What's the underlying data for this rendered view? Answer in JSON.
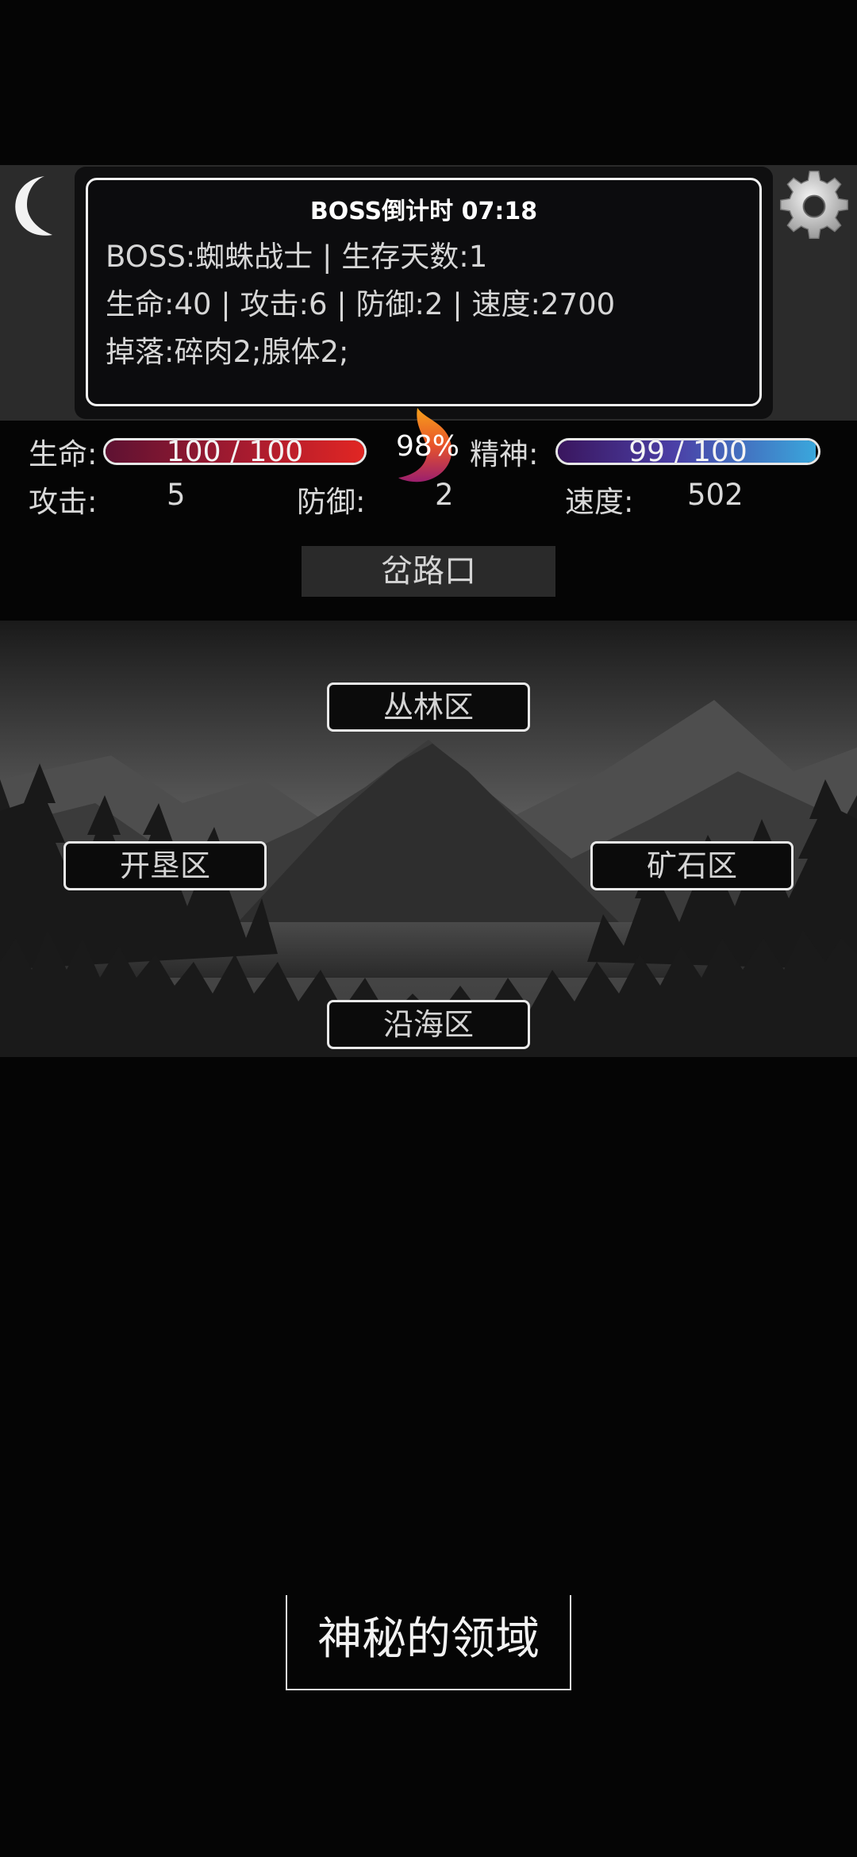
{
  "boss": {
    "title": "BOSS倒计时 07:18",
    "line1": "BOSS:蜘蛛战士 | 生存天数:1",
    "line2": "生命:40 | 攻击:6 | 防御:2 | 速度:2700",
    "line3": "掉落:碎肉2;腺体2;"
  },
  "stats": {
    "hp_label": "生命:",
    "hp_text": "100 / 100",
    "hp_fraction": 1.0,
    "spirit_percent": "98%",
    "mp_label": "精神:",
    "mp_text": "99 / 100",
    "mp_fraction": 0.99,
    "attack_label": "攻击:",
    "attack_value": "5",
    "defense_label": "防御:",
    "defense_value": "2",
    "speed_label": "速度:",
    "speed_value": "502"
  },
  "location": "岔路口",
  "zones": {
    "north": "丛林区",
    "west": "开垦区",
    "east": "矿石区",
    "south": "沿海区"
  },
  "footer": {
    "realm": "神秘的领域"
  },
  "icons": {
    "moon": "moon-icon",
    "settings": "gear-icon",
    "spirit": "flame-icon"
  },
  "colors": {
    "hp_bar": "#e12623",
    "mp_bar": "#3aa7dc",
    "background": "#050505"
  }
}
